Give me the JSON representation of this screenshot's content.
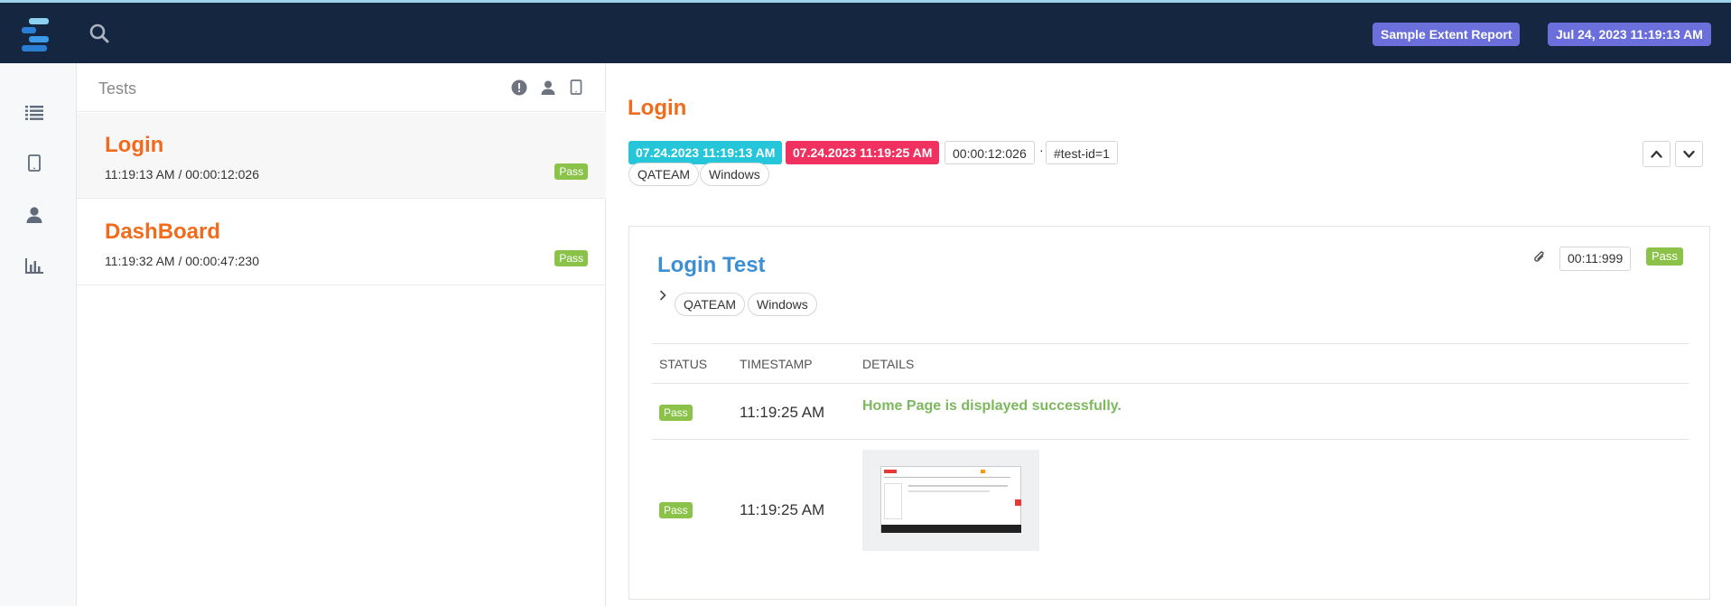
{
  "header": {
    "report_name": "Sample Extent Report",
    "report_date": "Jul 24, 2023 11:19:13 AM"
  },
  "colors": {
    "topbar": "#142640",
    "accent_orange": "#f16b1d",
    "pass_green": "#8bc34a",
    "start_cyan": "#26c6da",
    "end_red": "#f0315f",
    "badge_purple": "#6b6fdc",
    "card_title_blue": "#3d8fd3"
  },
  "sidebar": {
    "icons": [
      "list-icon",
      "tablet-icon",
      "user-icon",
      "bar-chart-icon"
    ]
  },
  "tests_panel": {
    "title": "Tests",
    "header_icons": [
      "exclamation-circle-icon",
      "user-icon",
      "tablet-icon"
    ],
    "items": [
      {
        "name": "Login",
        "time": "11:19:13 AM / 00:00:12:026",
        "status": "Pass"
      },
      {
        "name": "DashBoard",
        "time": "11:19:32 AM / 00:00:47:230",
        "status": "Pass"
      }
    ]
  },
  "detail": {
    "title": "Login",
    "start_time": "07.24.2023 11:19:13 AM",
    "end_time": "07.24.2023 11:19:25 AM",
    "duration": "00:00:12:026",
    "separator": "·",
    "test_id": "#test-id=1",
    "tags": [
      "QATEAM",
      "Windows"
    ],
    "node": {
      "title": "Login Test",
      "duration": "00:11:999",
      "status": "Pass",
      "tags": [
        "QATEAM",
        "Windows"
      ],
      "columns": [
        "STATUS",
        "TIMESTAMP",
        "DETAILS"
      ],
      "rows": [
        {
          "status": "Pass",
          "timestamp": "11:19:25 AM",
          "details": "Home Page is displayed successfully."
        },
        {
          "status": "Pass",
          "timestamp": "11:19:25 AM",
          "details": ""
        }
      ]
    }
  }
}
